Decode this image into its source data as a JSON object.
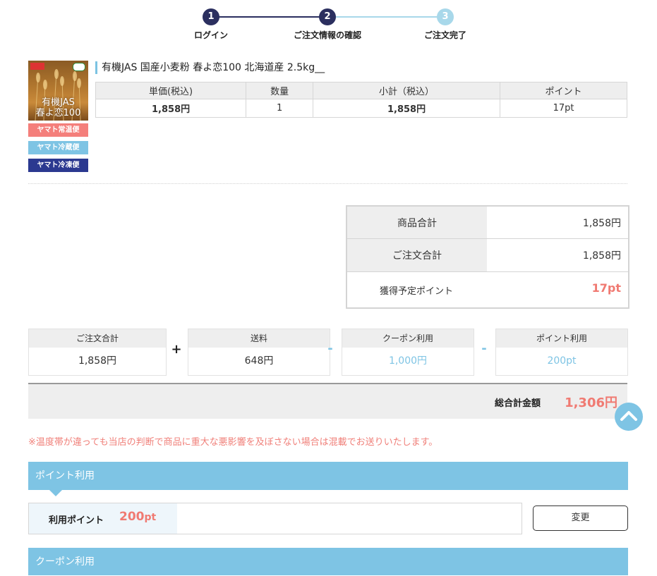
{
  "stepper": {
    "steps": [
      {
        "number": "1",
        "label": "ログイン"
      },
      {
        "number": "2",
        "label": "ご注文情報の確認"
      },
      {
        "number": "3",
        "label": "ご注文完了"
      }
    ],
    "current_step": 2,
    "colors": {
      "done": "#2b2f5f",
      "pending": "#a8d8ea"
    }
  },
  "product": {
    "image_text_line1": "有機JAS",
    "image_text_line2": "春よ恋100",
    "image_icons": [
      "brand-logo-icon",
      "organic-jas-icon",
      "wheat-icon"
    ],
    "shipping_tags": [
      {
        "label": "ヤマト常温便",
        "color": "#f47f7b"
      },
      {
        "label": "ヤマト冷蔵便",
        "color": "#7ec4e4"
      },
      {
        "label": "ヤマト冷凍便",
        "color": "#2b3990"
      }
    ],
    "title": "有機JAS 国産小麦粉 春よ恋100 北海道産 2.5kg__",
    "table": {
      "headers": [
        "単価(税込)",
        "数量",
        "小計（税込）",
        "ポイント"
      ],
      "values": [
        "1,858円",
        "1",
        "1,858円",
        "17pt"
      ]
    }
  },
  "summary": {
    "rows": [
      {
        "label": "商品合計",
        "value": "1,858円"
      },
      {
        "label": "ご注文合計",
        "value": "1,858円"
      },
      {
        "label": "獲得予定ポイント",
        "value": "17pt"
      }
    ]
  },
  "calc": {
    "items": [
      {
        "label": "ご注文合計",
        "value": "1,858円"
      },
      {
        "label": "送料",
        "value": "648円"
      },
      {
        "label": "クーポン利用",
        "value": "1,000円"
      },
      {
        "label": "ポイント利用",
        "value": "200pt"
      }
    ],
    "operators": [
      "+",
      "-",
      "-"
    ]
  },
  "total": {
    "label": "総合計金額",
    "value": "1,306円"
  },
  "back_to_top_icon": "chevron-up-icon",
  "notice": "※温度帯が違っても当店の判断で商品に重大な悪影響を及ぼさない場合は混載でお送りいたします。",
  "point_section": {
    "header": "ポイント利用",
    "label": "利用ポイント",
    "value": "200",
    "unit": "pt",
    "button": "変更"
  },
  "coupon_section": {
    "header": "クーポン利用"
  },
  "colors": {
    "accent_blue": "#7ec4e4",
    "accent_red": "#f07a72",
    "navy": "#2b2f5f"
  }
}
